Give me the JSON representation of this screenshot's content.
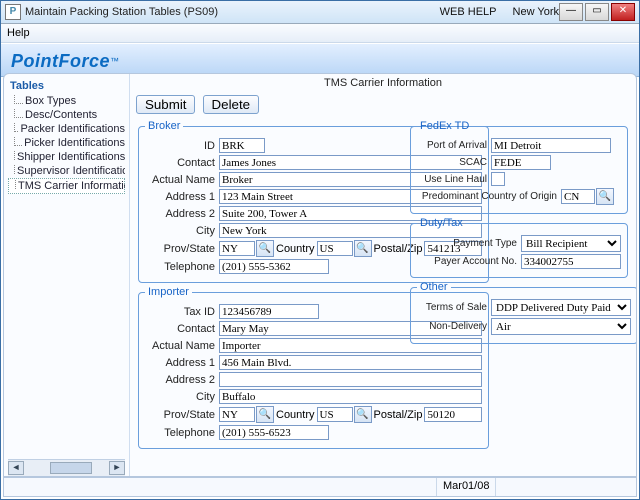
{
  "title": "Maintain Packing Station Tables (PS09)",
  "title_links": {
    "web_help": "WEB HELP",
    "location": "New York"
  },
  "menubar": {
    "help": "Help"
  },
  "brand": {
    "name": "PointForce",
    "tm": "™"
  },
  "sidebar": {
    "title": "Tables",
    "items": [
      {
        "label": "Box Types"
      },
      {
        "label": "Desc/Contents"
      },
      {
        "label": "Packer Identifications"
      },
      {
        "label": "Picker Identifications"
      },
      {
        "label": "Shipper Identifications"
      },
      {
        "label": "Supervisor Identifications"
      },
      {
        "label": "TMS Carrier Information"
      }
    ]
  },
  "main": {
    "title": "TMS Carrier Information",
    "buttons": {
      "submit": "Submit",
      "delete": "Delete"
    }
  },
  "broker": {
    "legend": "Broker",
    "labels": {
      "id": "ID",
      "contact": "Contact",
      "actual_name": "Actual Name",
      "addr1": "Address 1",
      "addr2": "Address 2",
      "city": "City",
      "prov": "Prov/State",
      "country": "Country",
      "postal": "Postal/Zip",
      "tel": "Telephone"
    },
    "id": "BRK",
    "contact": "James Jones",
    "actual_name": "Broker",
    "addr1": "123 Main Street",
    "addr2": "Suite 200, Tower A",
    "city": "New York",
    "prov": "NY",
    "country": "US",
    "postal": "541213",
    "tel": "(201) 555-5362"
  },
  "importer": {
    "legend": "Importer",
    "labels": {
      "taxid": "Tax ID",
      "contact": "Contact",
      "actual_name": "Actual Name",
      "addr1": "Address 1",
      "addr2": "Address 2",
      "city": "City",
      "prov": "Prov/State",
      "country": "Country",
      "postal": "Postal/Zip",
      "tel": "Telephone"
    },
    "taxid": "123456789",
    "contact": "Mary May",
    "actual_name": "Importer",
    "addr1": "456 Main Blvd.",
    "addr2": "",
    "city": "Buffalo",
    "prov": "NY",
    "country": "US",
    "postal": "50120",
    "tel": "(201) 555-6523"
  },
  "fedex": {
    "legend": "FedEx TD",
    "labels": {
      "port": "Port of Arrival",
      "scac": "SCAC",
      "line_haul": "Use Line Haul",
      "origin": "Predominant Country of Origin"
    },
    "port": "MI Detroit",
    "scac": "FEDE",
    "origin": "CN"
  },
  "duty": {
    "legend": "Duty/Tax",
    "labels": {
      "ptype": "Payment Type",
      "payer": "Payer Account No."
    },
    "ptype": "Bill Recipient",
    "payer": "334002755"
  },
  "other": {
    "legend": "Other",
    "labels": {
      "terms": "Terms of Sale",
      "nondeliv": "Non-Delivery"
    },
    "terms": "DDP Delivered Duty Paid",
    "nondeliv": "Air"
  },
  "status": {
    "date": "Mar01/08"
  }
}
